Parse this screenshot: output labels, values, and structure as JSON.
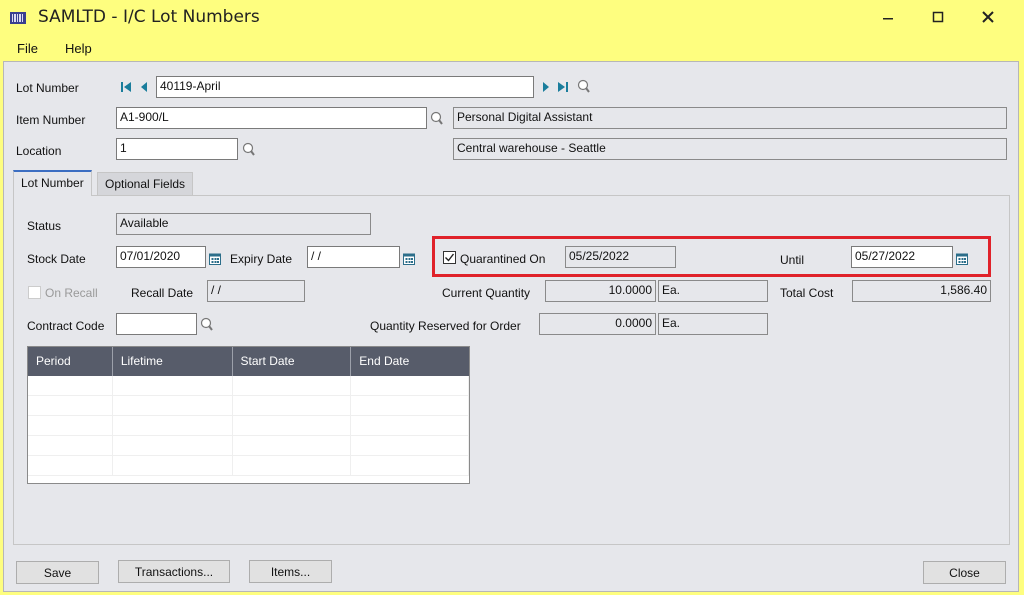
{
  "window": {
    "title": "SAMLTD - I/C Lot Numbers",
    "controls": {
      "minimize": "minimize",
      "maximize": "maximize",
      "close": "close"
    }
  },
  "menu": {
    "items": [
      "File",
      "Help"
    ]
  },
  "header": {
    "lot_number": {
      "label": "Lot Number",
      "value": "40119-April"
    },
    "item_number": {
      "label": "Item Number",
      "value": "A1-900/L",
      "description": "Personal  Digital Assistant"
    },
    "location": {
      "label": "Location",
      "value": "1",
      "description": "Central warehouse - Seattle"
    }
  },
  "tabs": [
    {
      "label": "Lot Number",
      "active": true
    },
    {
      "label": "Optional Fields",
      "active": false
    }
  ],
  "lot_tab": {
    "status": {
      "label": "Status",
      "value": "Available"
    },
    "stock_date": {
      "label": "Stock Date",
      "value": "07/01/2020"
    },
    "expiry_date": {
      "label": "Expiry Date",
      "value": " / /"
    },
    "quarantined_on": {
      "label": "Quarantined On",
      "checked": true,
      "value": "05/25/2022"
    },
    "until": {
      "label": "Until",
      "value": "05/27/2022"
    },
    "on_recall": {
      "label": "On Recall",
      "checked": false,
      "disabled": true
    },
    "recall_date": {
      "label": "Recall Date",
      "value": " / /"
    },
    "current_quantity": {
      "label": "Current Quantity",
      "value": "10.0000",
      "uom": "Ea."
    },
    "total_cost": {
      "label": "Total Cost",
      "value": "1,586.40"
    },
    "contract_code": {
      "label": "Contract Code",
      "value": ""
    },
    "qty_reserved": {
      "label": "Quantity Reserved for Order",
      "value": "0.0000",
      "uom": "Ea."
    }
  },
  "grid": {
    "columns": [
      "Period",
      "Lifetime",
      "Start Date",
      "End Date"
    ],
    "rows": []
  },
  "buttons": {
    "save": "Save",
    "transactions": "Transactions...",
    "items": "Items...",
    "close": "Close"
  },
  "colors": {
    "title_bar": "#fefe7f",
    "highlight": "#e0222a",
    "nav_arrow": "#1a7d9c",
    "grid_header": "#575c6a"
  }
}
